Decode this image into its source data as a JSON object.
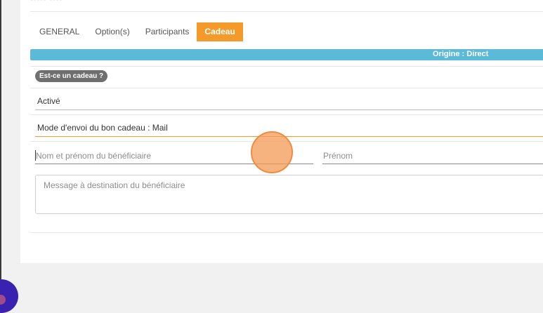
{
  "header": {
    "faded_title": "----- ----"
  },
  "tabs": [
    {
      "label": "GENERAL",
      "active": false
    },
    {
      "label": "Option(s)",
      "active": false
    },
    {
      "label": "Participants",
      "active": false
    },
    {
      "label": "Cadeau",
      "active": true
    }
  ],
  "origin_bar": {
    "text": "Origine : Direct",
    "color": "#5bbad8"
  },
  "gift": {
    "badge": "Est-ce un cadeau ?",
    "status_value": "Activé",
    "send_mode_value": "Mode d'envoi du bon cadeau : Mail",
    "beneficiary_name_placeholder": "Nom et prénom du bénéficiaire",
    "beneficiary_firstname_placeholder": "Prénom",
    "message_placeholder": "Message à destination du bénéficiaire"
  },
  "colors": {
    "accent": "#f39a2b",
    "info": "#5bbad8",
    "badge": "#6f6f6f"
  }
}
